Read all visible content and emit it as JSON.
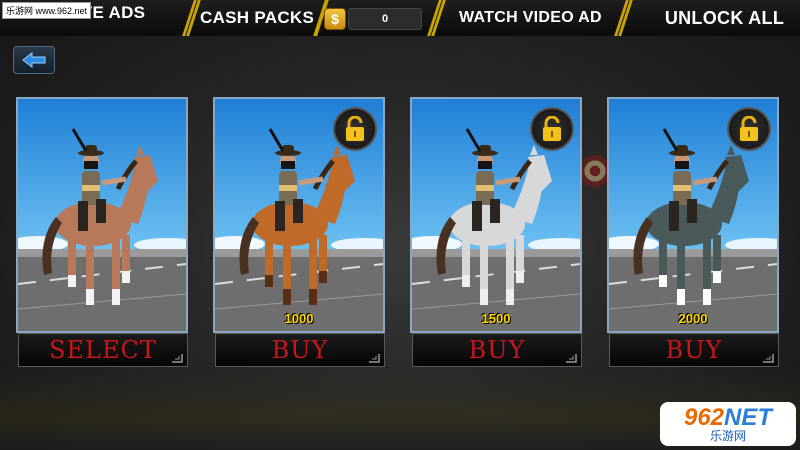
{
  "watermark_top": "乐游网 www.962.net",
  "topbar": {
    "remove_ads": "REMOVE ADS",
    "cash_packs": "CASH PACKS",
    "cash_icon": "$",
    "cash_value": "0",
    "watch_video": "WATCH VIDEO AD",
    "unlock_all": "UNLOCK ALL"
  },
  "back_icon": "arrow-left-icon",
  "cards": [
    {
      "horse_color": "#b8785a",
      "leg_color": "#f2f2f2",
      "price": "",
      "action": "SELECT",
      "locked": false
    },
    {
      "horse_color": "#c06a2a",
      "leg_color": "#5a2e14",
      "price": "1000",
      "action": "BUY",
      "locked": true
    },
    {
      "horse_color": "#d8d8d8",
      "leg_color": "#eeeeee",
      "price": "1500",
      "action": "BUY",
      "locked": true
    },
    {
      "horse_color": "#4a5a5a",
      "leg_color": "#ffffff",
      "price": "2000",
      "action": "BUY",
      "locked": true
    }
  ],
  "watermark_bottom": {
    "brand_part1": "962",
    "brand_part2": "NET",
    "sub": "乐游网"
  },
  "colors": {
    "accent_gold": "#c9a300",
    "price_yellow": "#ffd800",
    "action_red": "#c8161b",
    "sky_blue": "#3d9de0"
  }
}
